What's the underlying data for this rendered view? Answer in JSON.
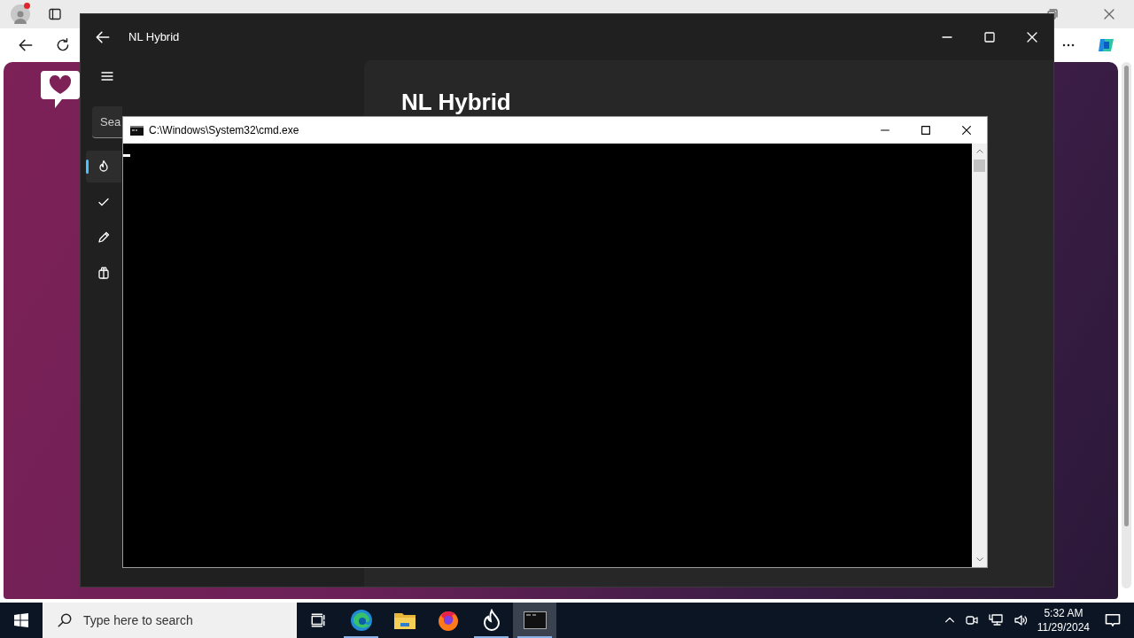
{
  "app_window": {
    "title": "NL Hybrid",
    "heading": "NL Hybrid",
    "search": {
      "value": "Sea"
    },
    "nav_items": [
      {
        "kind": "flame",
        "selected": true
      },
      {
        "kind": "check",
        "selected": false
      },
      {
        "kind": "pen",
        "selected": false
      },
      {
        "kind": "gift",
        "selected": false
      }
    ]
  },
  "console": {
    "title": "C:\\Windows\\System32\\cmd.exe"
  },
  "taskbar": {
    "search_placeholder": "Type here to search",
    "apps": [
      {
        "kind": "edge",
        "running": true,
        "selected": false
      },
      {
        "kind": "folder",
        "running": false,
        "selected": false
      },
      {
        "kind": "firefox",
        "running": false,
        "selected": false
      },
      {
        "kind": "flame",
        "running": true,
        "selected": false
      },
      {
        "kind": "console",
        "running": true,
        "selected": true
      }
    ],
    "time": "5:32 AM",
    "date": "11/29/2024"
  }
}
